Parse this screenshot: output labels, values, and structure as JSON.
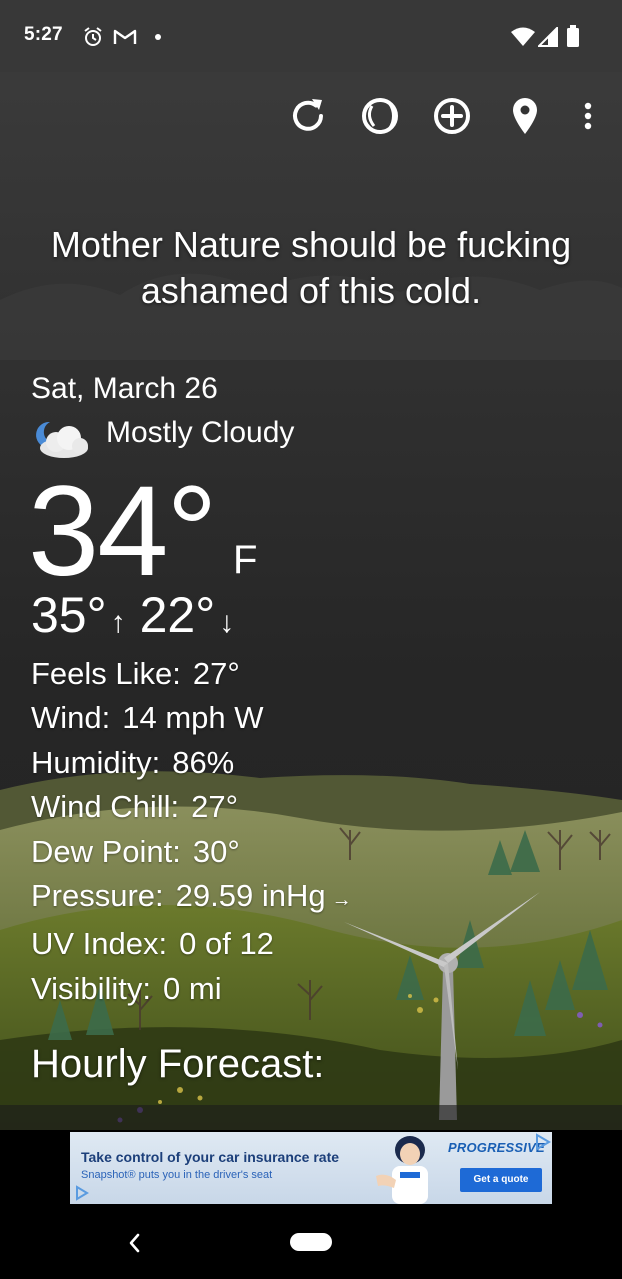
{
  "status_bar": {
    "time": "5:27",
    "icons": [
      "alarm-icon",
      "gmail-icon",
      "dot-icon",
      "wifi-icon",
      "signal-icon",
      "battery-icon"
    ]
  },
  "app_bar": {
    "actions": [
      "refresh-icon",
      "theme-icon",
      "add-location-icon",
      "location-pin-icon",
      "more-options-icon"
    ]
  },
  "quote": "Mother Nature should be fucking ashamed of this cold.",
  "weather": {
    "date": "Sat, March 26",
    "condition_icon": "partly-cloudy-night-icon",
    "condition": "Mostly Cloudy",
    "temperature": "34°",
    "unit": "F",
    "high": "35°",
    "high_arrow": "↑",
    "low": "22°",
    "low_arrow": "↓"
  },
  "details": [
    {
      "label": "Feels Like:",
      "value": "27°"
    },
    {
      "label": "Wind:",
      "value": "14 mph W"
    },
    {
      "label": "Humidity:",
      "value": "86%"
    },
    {
      "label": "Wind Chill:",
      "value": "27°"
    },
    {
      "label": "Dew Point:",
      "value": "30°"
    },
    {
      "label": "Pressure:",
      "value": "29.59 inHg",
      "trend": "→"
    },
    {
      "label": "UV Index:",
      "value": "0 of 12"
    },
    {
      "label": "Visibility:",
      "value": "0 mi"
    }
  ],
  "hourly_heading": "Hourly Forecast:",
  "ad": {
    "headline": "Take control of your car insurance rate",
    "subline": "Snapshot® puts you in the driver's seat",
    "brand": "PROGRESSIVE",
    "cta": "Get a quote"
  },
  "colors": {
    "status_bar": "#383838",
    "sky": "#2a2a2a",
    "hills": "#6f7f3a",
    "ad_blue": "#1e6ad6"
  }
}
